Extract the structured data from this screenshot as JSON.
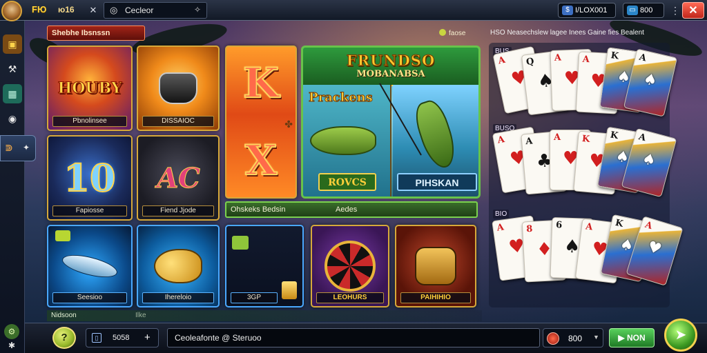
{
  "topbar": {
    "logo": "FЮ",
    "title": "ю16",
    "search_text": "Cecleor",
    "balance_1": "I/LOX001",
    "balance_2": "800",
    "close_label": "✕"
  },
  "category": {
    "tab_label": "Shebhe Ibsnssn",
    "hint_text": "faose"
  },
  "tiles": [
    {
      "label": "Pbnolinsee",
      "art": "HOUBY"
    },
    {
      "label": "DISSAIOC",
      "art": ""
    },
    {
      "label": "Fapiosse",
      "art": "10"
    },
    {
      "label": "Fiend Jjode",
      "art": "AC"
    },
    {
      "label": "Seesioo",
      "art": ""
    },
    {
      "label": "Ihereloio",
      "art": ""
    },
    {
      "label": "3GP",
      "art": ""
    },
    {
      "label": "LEOHURS",
      "art": ""
    },
    {
      "label": "PAIHIHIO",
      "art": ""
    }
  ],
  "big_tile": {
    "letter_top": "K",
    "letter_bottom": "X"
  },
  "featured": {
    "title_line1": "FRUNDSO",
    "title_line2": "MOBANABSA",
    "subtitle": "Prackens",
    "label_left": "ROVCS",
    "label_right": "PIHSKAN",
    "bar_left": "Ohskeks Bedsin",
    "bar_right": "Aedes"
  },
  "cards_panel": {
    "header": "HSO Neasechslew lagee Inees Gaine fies Bealent",
    "row1_label": "BUS",
    "row2_label": "BUSO",
    "row3_label": "BIO",
    "row1": [
      {
        "rank": "A",
        "suit": "♥",
        "color": "red"
      },
      {
        "rank": "Q",
        "suit": "♠",
        "color": "black"
      },
      {
        "rank": "A",
        "suit": "♥",
        "color": "red"
      },
      {
        "rank": "A",
        "suit": "♥",
        "color": "red"
      },
      {
        "rank": "K",
        "suit": "♠",
        "color": "black"
      },
      {
        "rank": "A",
        "suit": "♠",
        "color": "black"
      }
    ],
    "row2": [
      {
        "rank": "A",
        "suit": "♥",
        "color": "red"
      },
      {
        "rank": "A",
        "suit": "♣",
        "color": "black"
      },
      {
        "rank": "A",
        "suit": "♥",
        "color": "red"
      },
      {
        "rank": "K",
        "suit": "♥",
        "color": "red"
      },
      {
        "rank": "K",
        "suit": "♠",
        "color": "black"
      },
      {
        "rank": "A",
        "suit": "♠",
        "color": "black"
      }
    ],
    "row3": [
      {
        "rank": "A",
        "suit": "♥",
        "color": "red"
      },
      {
        "rank": "8",
        "suit": "♦",
        "color": "red"
      },
      {
        "rank": "6",
        "suit": "♠",
        "color": "black"
      },
      {
        "rank": "A",
        "suit": "♥",
        "color": "red"
      },
      {
        "rank": "K",
        "suit": "♠",
        "color": "black"
      },
      {
        "rank": "A",
        "suit": "♥",
        "color": "red"
      }
    ]
  },
  "footer": {
    "section_label": "Nidsoon",
    "section_sub": "Ilke",
    "wallet_amount": "5058",
    "chat_text": "Ceoleafonte @ Steruoo",
    "bet_amount": "800",
    "win_label": "NON",
    "help_label": "?"
  },
  "colors": {
    "accent_gold": "#d7a93a",
    "accent_green": "#67c44a",
    "close_red": "#c0261b"
  }
}
